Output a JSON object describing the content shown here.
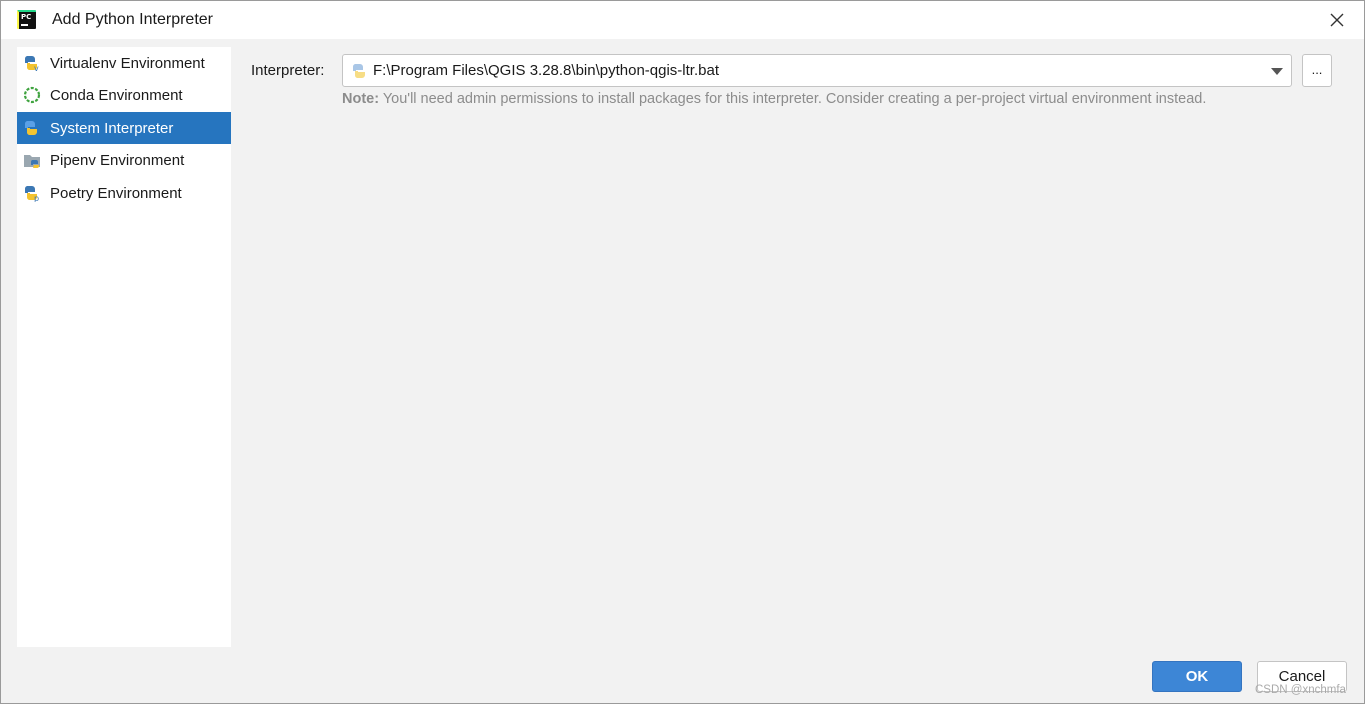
{
  "window": {
    "title": "Add Python Interpreter"
  },
  "sidebar": {
    "items": [
      {
        "label": "Virtualenv Environment",
        "icon": "python-venv-icon",
        "selected": false
      },
      {
        "label": "Conda Environment",
        "icon": "conda-icon",
        "selected": false
      },
      {
        "label": "System Interpreter",
        "icon": "python-icon",
        "selected": true
      },
      {
        "label": "Pipenv Environment",
        "icon": "pipenv-icon",
        "selected": false
      },
      {
        "label": "Poetry Environment",
        "icon": "poetry-icon",
        "selected": false
      }
    ]
  },
  "main": {
    "interpreter_label": "Interpreter:",
    "interpreter_value": "F:\\Program Files\\QGIS 3.28.8\\bin\\python-qgis-ltr.bat",
    "browse_label": "...",
    "note_prefix": "Note:",
    "note_text": " You'll need admin permissions to install packages for this interpreter. Consider creating a per-project virtual environment instead."
  },
  "footer": {
    "ok_label": "OK",
    "cancel_label": "Cancel",
    "watermark": "CSDN @xnchmfa"
  },
  "colors": {
    "accent": "#2675bf",
    "ok_button": "#3d86d6",
    "background": "#f2f2f2"
  }
}
